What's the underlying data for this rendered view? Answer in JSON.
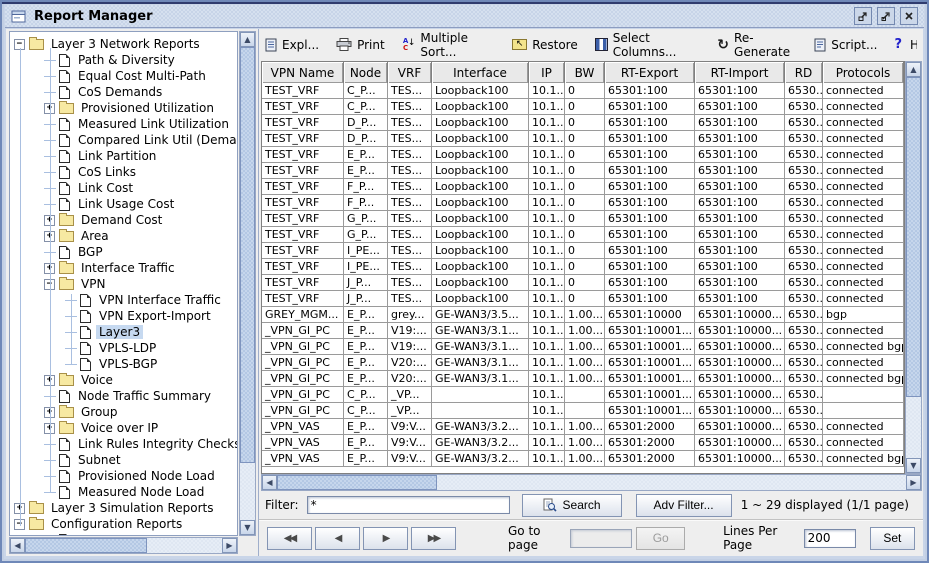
{
  "window": {
    "title": "Report Manager"
  },
  "tree": {
    "items": [
      {
        "label": "Layer 3 Network Reports",
        "kind": "folder",
        "depth": 0,
        "expander": "minus"
      },
      {
        "label": "Path & Diversity",
        "kind": "doc",
        "depth": 1
      },
      {
        "label": "Equal Cost Multi-Path",
        "kind": "doc",
        "depth": 1
      },
      {
        "label": "CoS Demands",
        "kind": "doc",
        "depth": 1
      },
      {
        "label": "Provisioned Utilization",
        "kind": "folder",
        "depth": 1,
        "expander": "plus"
      },
      {
        "label": "Measured Link Utilization",
        "kind": "doc",
        "depth": 1
      },
      {
        "label": "Compared Link Util (Demand",
        "kind": "doc",
        "depth": 1
      },
      {
        "label": "Link Partition",
        "kind": "doc",
        "depth": 1
      },
      {
        "label": "CoS Links",
        "kind": "doc",
        "depth": 1
      },
      {
        "label": "Link Cost",
        "kind": "doc",
        "depth": 1
      },
      {
        "label": "Link Usage Cost",
        "kind": "doc",
        "depth": 1
      },
      {
        "label": "Demand Cost",
        "kind": "folder",
        "depth": 1,
        "expander": "plus"
      },
      {
        "label": "Area",
        "kind": "folder",
        "depth": 1,
        "expander": "plus"
      },
      {
        "label": "BGP",
        "kind": "doc",
        "depth": 1
      },
      {
        "label": "Interface Traffic",
        "kind": "folder",
        "depth": 1,
        "expander": "plus"
      },
      {
        "label": "VPN",
        "kind": "folder",
        "depth": 1,
        "expander": "minus"
      },
      {
        "label": "VPN Interface Traffic",
        "kind": "doc",
        "depth": 2
      },
      {
        "label": "VPN Export-Import",
        "kind": "doc",
        "depth": 2
      },
      {
        "label": "Layer3",
        "kind": "doc",
        "depth": 2,
        "selected": true
      },
      {
        "label": "VPLS-LDP",
        "kind": "doc",
        "depth": 2
      },
      {
        "label": "VPLS-BGP",
        "kind": "doc",
        "depth": 2
      },
      {
        "label": "Voice",
        "kind": "folder",
        "depth": 1,
        "expander": "plus"
      },
      {
        "label": "Node Traffic Summary",
        "kind": "doc",
        "depth": 1
      },
      {
        "label": "Group",
        "kind": "folder",
        "depth": 1,
        "expander": "plus"
      },
      {
        "label": "Voice over IP",
        "kind": "folder",
        "depth": 1,
        "expander": "plus"
      },
      {
        "label": "Link Rules Integrity Checks",
        "kind": "doc",
        "depth": 1
      },
      {
        "label": "Subnet",
        "kind": "doc",
        "depth": 1
      },
      {
        "label": "Provisioned Node Load",
        "kind": "doc",
        "depth": 1
      },
      {
        "label": "Measured Node Load",
        "kind": "doc",
        "depth": 1
      },
      {
        "label": "Layer 3 Simulation Reports",
        "kind": "folder",
        "depth": 0,
        "expander": "plus"
      },
      {
        "label": "Configuration Reports",
        "kind": "folder",
        "depth": 0,
        "expander": "minus"
      },
      {
        "label": "",
        "kind": "doc",
        "depth": 1
      }
    ]
  },
  "toolbar": {
    "buttons": [
      {
        "id": "explanation",
        "label": "Expl...",
        "icon": "document-icon"
      },
      {
        "id": "print",
        "label": "Print",
        "icon": "printer-icon"
      },
      {
        "id": "multiple-sort",
        "label": "Multiple Sort...",
        "icon": "sort-icon"
      },
      {
        "id": "restore",
        "label": "Restore",
        "icon": "restore-folder-icon"
      },
      {
        "id": "select-columns",
        "label": "Select Columns...",
        "icon": "columns-icon"
      },
      {
        "id": "re-generate",
        "label": "Re-Generate",
        "icon": "refresh-icon"
      },
      {
        "id": "script",
        "label": "Script...",
        "icon": "script-icon"
      }
    ],
    "help_label": "?",
    "help_clipped": "H"
  },
  "table": {
    "columns": [
      "VPN Name",
      "Node",
      "VRF",
      "Interface",
      "IP",
      "BW",
      "RT-Export",
      "RT-Import",
      "RD",
      "Protocols"
    ],
    "rows": [
      [
        "TEST_VRF",
        "C_P...",
        "TES...",
        "Loopback100",
        "10.1...",
        "0",
        "65301:100",
        "65301:100",
        "6530...",
        "connected"
      ],
      [
        "TEST_VRF",
        "C_P...",
        "TES...",
        "Loopback100",
        "10.1...",
        "0",
        "65301:100",
        "65301:100",
        "6530...",
        "connected"
      ],
      [
        "TEST_VRF",
        "D_P...",
        "TES...",
        "Loopback100",
        "10.1...",
        "0",
        "65301:100",
        "65301:100",
        "6530...",
        "connected"
      ],
      [
        "TEST_VRF",
        "D_P...",
        "TES...",
        "Loopback100",
        "10.1...",
        "0",
        "65301:100",
        "65301:100",
        "6530...",
        "connected"
      ],
      [
        "TEST_VRF",
        "E_P...",
        "TES...",
        "Loopback100",
        "10.1...",
        "0",
        "65301:100",
        "65301:100",
        "6530...",
        "connected"
      ],
      [
        "TEST_VRF",
        "E_P...",
        "TES...",
        "Loopback100",
        "10.1...",
        "0",
        "65301:100",
        "65301:100",
        "6530...",
        "connected"
      ],
      [
        "TEST_VRF",
        "F_P...",
        "TES...",
        "Loopback100",
        "10.1...",
        "0",
        "65301:100",
        "65301:100",
        "6530...",
        "connected"
      ],
      [
        "TEST_VRF",
        "F_P...",
        "TES...",
        "Loopback100",
        "10.1...",
        "0",
        "65301:100",
        "65301:100",
        "6530...",
        "connected"
      ],
      [
        "TEST_VRF",
        "G_P...",
        "TES...",
        "Loopback100",
        "10.1...",
        "0",
        "65301:100",
        "65301:100",
        "6530...",
        "connected"
      ],
      [
        "TEST_VRF",
        "G_P...",
        "TES...",
        "Loopback100",
        "10.1...",
        "0",
        "65301:100",
        "65301:100",
        "6530...",
        "connected"
      ],
      [
        "TEST_VRF",
        "I_PE...",
        "TES...",
        "Loopback100",
        "10.1...",
        "0",
        "65301:100",
        "65301:100",
        "6530...",
        "connected"
      ],
      [
        "TEST_VRF",
        "I_PE...",
        "TES...",
        "Loopback100",
        "10.1...",
        "0",
        "65301:100",
        "65301:100",
        "6530...",
        "connected"
      ],
      [
        "TEST_VRF",
        "J_P...",
        "TES...",
        "Loopback100",
        "10.1...",
        "0",
        "65301:100",
        "65301:100",
        "6530...",
        "connected"
      ],
      [
        "TEST_VRF",
        "J_P...",
        "TES...",
        "Loopback100",
        "10.1...",
        "0",
        "65301:100",
        "65301:100",
        "6530...",
        "connected"
      ],
      [
        "GREY_MGM...",
        "E_P...",
        "grey...",
        "GE-WAN3/3.5...",
        "10.1...",
        "1.00...",
        "65301:10000",
        "65301:10000...",
        "6530...",
        "bgp"
      ],
      [
        "_VPN_GI_PC",
        "E_P...",
        "V19:...",
        "GE-WAN3/3.1...",
        "10.1...",
        "1.00...",
        "65301:10001...",
        "65301:10000...",
        "6530...",
        "connected"
      ],
      [
        "_VPN_GI_PC",
        "E_P...",
        "V19:...",
        "GE-WAN3/3.1...",
        "10.1...",
        "1.00...",
        "65301:10001...",
        "65301:10000...",
        "6530...",
        "connected bgp"
      ],
      [
        "_VPN_GI_PC",
        "E_P...",
        "V20:...",
        "GE-WAN3/3.1...",
        "10.1...",
        "1.00...",
        "65301:10001...",
        "65301:10000...",
        "6530...",
        "connected"
      ],
      [
        "_VPN_GI_PC",
        "E_P...",
        "V20:...",
        "GE-WAN3/3.1...",
        "10.1...",
        "1.00...",
        "65301:10001...",
        "65301:10000...",
        "6530...",
        "connected bgp"
      ],
      [
        "_VPN_GI_PC",
        "C_P...",
        "_VP...",
        "",
        "10.1...",
        "",
        "65301:10001...",
        "65301:10000...",
        "6530...",
        ""
      ],
      [
        "_VPN_GI_PC",
        "C_P...",
        "_VP...",
        "",
        "10.1...",
        "",
        "65301:10001...",
        "65301:10000...",
        "6530...",
        ""
      ],
      [
        "_VPN_VAS",
        "E_P...",
        "V9:V...",
        "GE-WAN3/3.2...",
        "10.1...",
        "1.00...",
        "65301:2000",
        "65301:10000...",
        "6530...",
        "connected"
      ],
      [
        "_VPN_VAS",
        "E_P...",
        "V9:V...",
        "GE-WAN3/3.2...",
        "10.1...",
        "1.00...",
        "65301:2000",
        "65301:10000...",
        "6530...",
        "connected"
      ],
      [
        "_VPN_VAS",
        "E_P...",
        "V9:V...",
        "GE-WAN3/3.2...",
        "10.1...",
        "1.00...",
        "65301:2000",
        "65301:10000...",
        "6530...",
        "connected bgp"
      ]
    ]
  },
  "filter": {
    "label": "Filter:",
    "value": "*",
    "search_label": "Search",
    "adv_filter_label": "Adv Filter...",
    "status": "1 ~ 29 displayed (1/1 page)"
  },
  "pagination": {
    "nav": [
      {
        "name": "first-page",
        "glyph": "◀◀"
      },
      {
        "name": "prev-page",
        "glyph": "◀"
      },
      {
        "name": "next-page",
        "glyph": "▶"
      },
      {
        "name": "last-page",
        "glyph": "▶▶"
      }
    ],
    "goto_label": "Go to page",
    "goto_value": "",
    "go_label": "Go",
    "lines_label": "Lines Per Page",
    "lines_value": "200",
    "set_label": "Set"
  },
  "colors": {
    "titlebar": "#C7D4E8",
    "selection": "#C6D9F0",
    "folder": "#F7E9A2",
    "scroll_thumb": "#B4C8E4",
    "grid_line": "#9A9A9A"
  }
}
